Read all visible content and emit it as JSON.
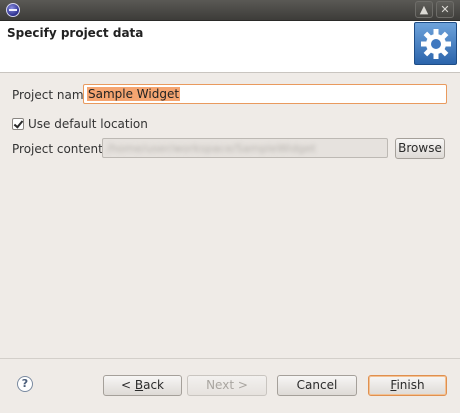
{
  "window": {
    "app_icon": "eclipse-icon",
    "controls": {
      "minimize": "▲",
      "close": "✕"
    }
  },
  "header": {
    "title": "Specify project data",
    "badge_icon": "gear-icon"
  },
  "form": {
    "project_name_label": "Project name",
    "project_name_value": "Sample Widget",
    "use_default_label": "Use default location",
    "use_default_checked": true,
    "contents_label": "Project contents:",
    "contents_value": "/home/user/workspace/SampleWidget",
    "browse_label": "Browse"
  },
  "footer": {
    "help_icon": "help-icon",
    "back_mnemonic": "B",
    "back_rest": "ack",
    "back_prefix": "< ",
    "next_label": "Next >",
    "cancel_label": "Cancel",
    "finish_mnemonic": "F",
    "finish_rest": "inish"
  },
  "colors": {
    "accent": "#e99a5e",
    "selection": "#f5a571",
    "badge": "#2b64ab"
  }
}
